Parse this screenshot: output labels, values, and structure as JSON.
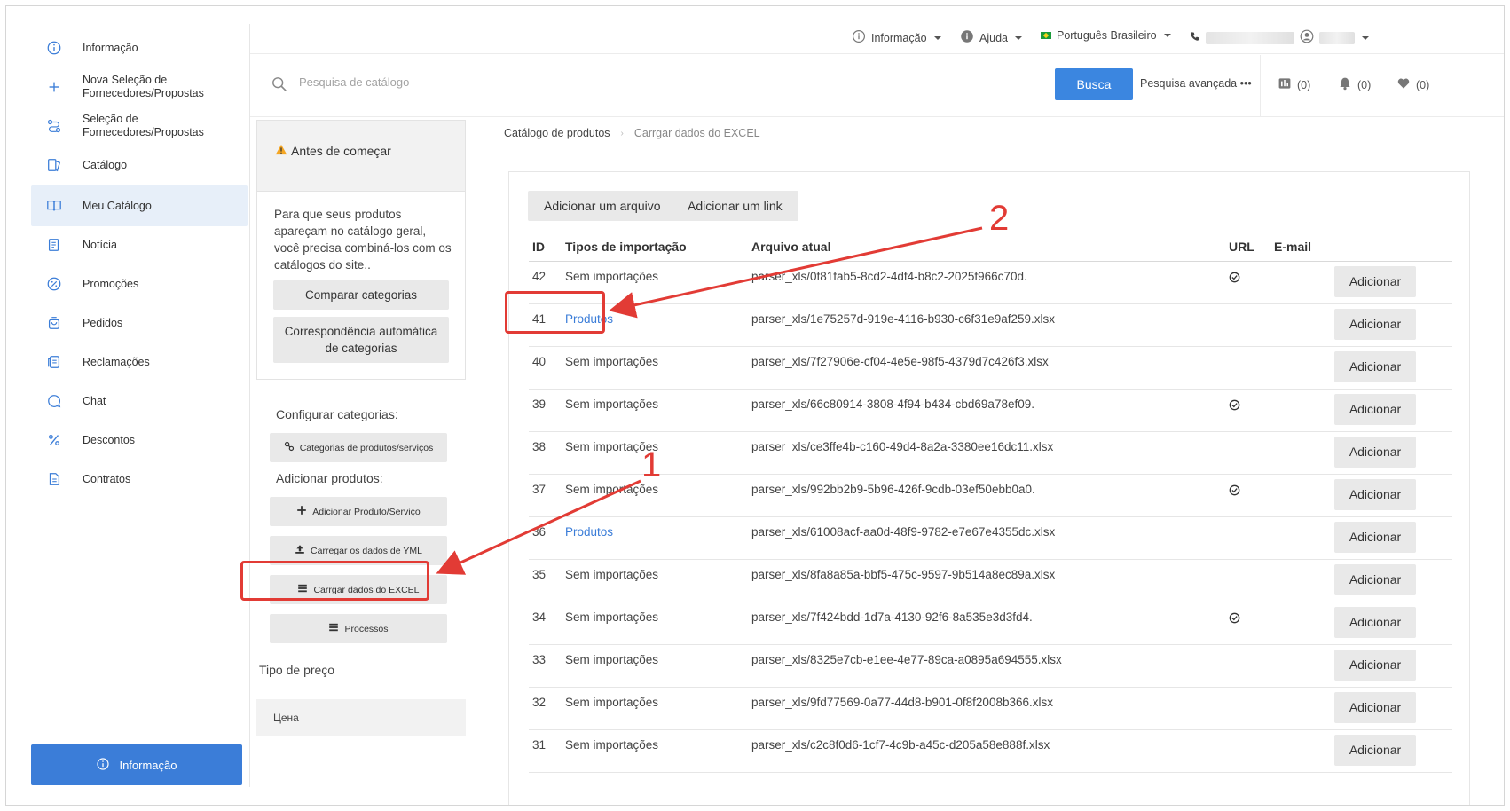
{
  "sidebar": {
    "items": [
      {
        "label": "Informação",
        "icon": "info-icon"
      },
      {
        "label": "Nova Seleção de Fornecedores/Propostas",
        "icon": "plus-icon"
      },
      {
        "label": "Seleção de Fornecedores/Propostas",
        "icon": "routes-icon"
      },
      {
        "label": "Catálogo",
        "icon": "catalog-icon"
      },
      {
        "label": "Meu Catálogo",
        "icon": "book-icon",
        "active": true
      },
      {
        "label": "Notícia",
        "icon": "news-icon"
      },
      {
        "label": "Promoções",
        "icon": "promo-icon"
      },
      {
        "label": "Pedidos",
        "icon": "bag-icon"
      },
      {
        "label": "Reclamações",
        "icon": "complaint-icon"
      },
      {
        "label": "Chat",
        "icon": "chat-icon"
      },
      {
        "label": "Descontos",
        "icon": "percent-icon"
      },
      {
        "label": "Contratos",
        "icon": "document-icon"
      }
    ],
    "info_button": "Informação"
  },
  "topbar": {
    "info": "Informação",
    "help": "Ajuda",
    "language": "Português Brasileiro"
  },
  "search": {
    "placeholder": "Pesquisa de catálogo",
    "button": "Busca",
    "advanced": "Pesquisa avançada •••",
    "compare_count": "(0)",
    "notify_count": "(0)",
    "favorites_count": "(0)"
  },
  "left_panel": {
    "title": "Antes de começar",
    "description": "Para que seus produtos apareçam no catálogo geral, você precisa combiná-los com os catálogos do site..",
    "compare_button": "Comparar categorias",
    "auto_match_button": "Correspondência automática de categorias",
    "config_label": "Configurar categorias:",
    "categories_button": "Categorias de produtos/serviços",
    "add_label": "Adicionar produtos:",
    "add_product_button": "Adicionar Produto/Serviço",
    "yml_button": "Carregar os dados de YML",
    "excel_button": "Carrgar dados do EXCEL",
    "process_button": "Processos",
    "price_type_label": "Tipo de preço",
    "price_value": "Цена"
  },
  "breadcrumb": {
    "root": "Catálogo de produtos",
    "current": "Carrgar dados do EXCEL"
  },
  "main": {
    "add_file_button": "Adicionar um arquivo",
    "add_link_button": "Adicionar um link",
    "headers": {
      "id": "ID",
      "tipo": "Tipos de importação",
      "arquivo": "Arquivo atual",
      "url": "URL",
      "email": "E-mail"
    },
    "add_label": "Adicionar",
    "rows": [
      {
        "id": "42",
        "tipo": "Sem importações",
        "link": false,
        "arquivo": "parser_xls/0f81fab5-8cd2-4df4-b8c2-2025f966c70d.",
        "url": true
      },
      {
        "id": "41",
        "tipo": "Produtos",
        "link": true,
        "arquivo": "parser_xls/1e75257d-919e-4116-b930-c6f31e9af259.xlsx",
        "url": false
      },
      {
        "id": "40",
        "tipo": "Sem importações",
        "link": false,
        "arquivo": "parser_xls/7f27906e-cf04-4e5e-98f5-4379d7c426f3.xlsx",
        "url": false
      },
      {
        "id": "39",
        "tipo": "Sem importações",
        "link": false,
        "arquivo": "parser_xls/66c80914-3808-4f94-b434-cbd69a78ef09.",
        "url": true
      },
      {
        "id": "38",
        "tipo": "Sem importações",
        "link": false,
        "arquivo": "parser_xls/ce3ffe4b-c160-49d4-8a2a-3380ee16dc11.xlsx",
        "url": false
      },
      {
        "id": "37",
        "tipo": "Sem importações",
        "link": false,
        "arquivo": "parser_xls/992bb2b9-5b96-426f-9cdb-03ef50ebb0a0.",
        "url": true
      },
      {
        "id": "36",
        "tipo": "Produtos",
        "link": true,
        "arquivo": "parser_xls/61008acf-aa0d-48f9-9782-e7e67e4355dc.xlsx",
        "url": false
      },
      {
        "id": "35",
        "tipo": "Sem importações",
        "link": false,
        "arquivo": "parser_xls/8fa8a85a-bbf5-475c-9597-9b514a8ec89a.xlsx",
        "url": false
      },
      {
        "id": "34",
        "tipo": "Sem importações",
        "link": false,
        "arquivo": "parser_xls/7f424bdd-1d7a-4130-92f6-8a535e3d3fd4.",
        "url": true
      },
      {
        "id": "33",
        "tipo": "Sem importações",
        "link": false,
        "arquivo": "parser_xls/8325e7cb-e1ee-4e77-89ca-a0895a694555.xlsx",
        "url": false
      },
      {
        "id": "32",
        "tipo": "Sem importações",
        "link": false,
        "arquivo": "parser_xls/9fd77569-0a77-44d8-b901-0f8f2008b366.xlsx",
        "url": false
      },
      {
        "id": "31",
        "tipo": "Sem importações",
        "link": false,
        "arquivo": "parser_xls/c2c8f0d6-1cf7-4c9b-a45c-d205a58e888f.xlsx",
        "url": false
      }
    ]
  },
  "annotations": {
    "label_1": "1",
    "label_2": "2",
    "color": "#e23b35"
  }
}
